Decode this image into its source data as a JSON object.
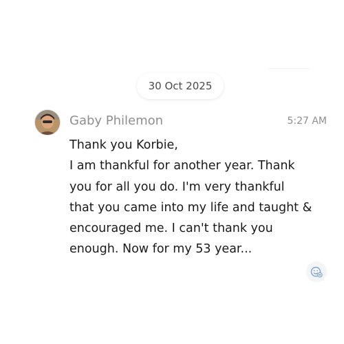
{
  "date_divider": "30 Oct 2025",
  "message": {
    "sender": "Gaby Philemon",
    "time": "5:27 AM",
    "lines": [
      "Thank you Korbie,",
      "I am thankful for another year. Thank",
      "you for all you do.  I'm very thankful",
      "that you came into my life and taught &",
      "encouraged me.  I can't thank you",
      "enough. Now for my 53 year..."
    ]
  },
  "icons": {
    "avatar": "user-photo",
    "reaction": "add-reaction-icon"
  },
  "colors": {
    "sender": "#8e8e8e",
    "text": "#1a1a1a",
    "reaction_icon": "#7ea6cf"
  }
}
